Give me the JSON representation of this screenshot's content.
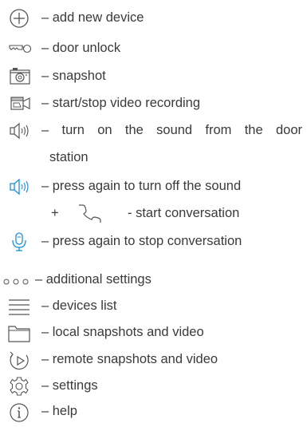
{
  "legend": {
    "rows": [
      {
        "icon": "plus-circle-icon",
        "text": "– add new device"
      },
      {
        "icon": "key-icon",
        "text": "– door unlock"
      },
      {
        "icon": "camera-icon",
        "text": "– snapshot"
      },
      {
        "icon": "video-record-icon",
        "text": "– start/stop video recording"
      },
      {
        "icon": "speaker-icon",
        "text": "– turn on the sound from the door",
        "text_cont": "station"
      },
      {
        "icon": "speaker-active-icon",
        "text": "– press again to turn off the sound"
      },
      {
        "prefix": "+",
        "icon": "phone-handset-icon",
        "text": "- start conversation"
      },
      {
        "icon": "microphone-active-icon",
        "text": "– press again to stop conversation"
      },
      {
        "icon": "more-dots-icon",
        "text": "– additional settings"
      },
      {
        "icon": "list-icon",
        "text": "– devices list"
      },
      {
        "icon": "folder-icon",
        "text": "– local snapshots and video"
      },
      {
        "icon": "remote-playback-icon",
        "text": "– remote snapshots and video"
      },
      {
        "icon": "gear-icon",
        "text": "– settings"
      },
      {
        "icon": "info-icon",
        "text": "– help"
      }
    ]
  },
  "colors": {
    "text": "#3a3a3a",
    "icon": "#555555",
    "accent": "#1a8fd6"
  }
}
